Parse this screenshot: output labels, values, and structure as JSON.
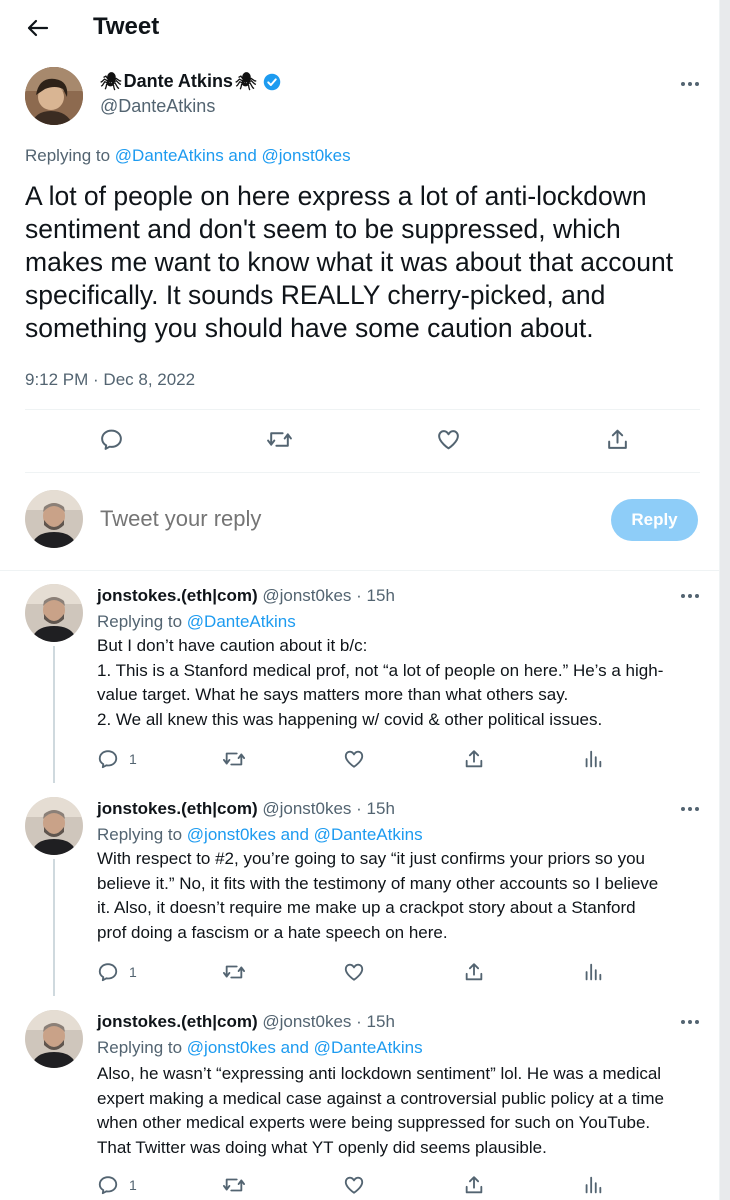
{
  "header": {
    "title": "Tweet"
  },
  "tweet": {
    "author_name": "Dante Atkins",
    "author_handle": "@DanteAtkins",
    "replying_prefix": "Replying to",
    "replying_to": "@DanteAtkins and @jonst0kes",
    "text": "A lot of people on here express a lot of anti-lockdown sentiment and don't seem to be suppressed, which makes me want to know what it was about that account specifically. It sounds REALLY cherry-picked, and something you should have some caution about.",
    "timestamp": "9:12 PM · Dec 8, 2022"
  },
  "compose": {
    "placeholder": "Tweet your reply",
    "button": "Reply"
  },
  "replies": [
    {
      "name": "jonstokes.(eth|com)",
      "meta": "@jonst0kes · 15h",
      "replying_to": "@DanteAtkins",
      "text_lines": [
        "But I don’t have caution about it b/c:",
        "1. This is a Stanford medical prof, not “a lot of people on here.” He’s a high-",
        "value target. What he says matters more than what others say.",
        "2. We all knew this was happening w/ covid & other political issues."
      ],
      "reply_count": "1"
    },
    {
      "name": "jonstokes.(eth|com)",
      "meta": "@jonst0kes · 15h",
      "replying_to": "@jonst0kes and @DanteAtkins",
      "text_lines": [
        "With respect to #2, you’re going to say “it just confirms your priors so you",
        "believe it.” No, it fits with the testimony of many other accounts so I believe",
        "it. Also, it doesn’t require me make up a crackpot story about a Stanford",
        "prof doing a fascism or a hate speech on here."
      ],
      "reply_count": "1"
    },
    {
      "name": "jonstokes.(eth|com)",
      "meta": "@jonst0kes · 15h",
      "replying_to": "@jonst0kes and @DanteAtkins",
      "text_lines": [
        "Also, he wasn’t “expressing anti lockdown sentiment” lol. He was a medical",
        "expert making a medical case against a controversial public policy at a time",
        "when other medical experts were being suppressed for such on YouTube.",
        "That Twitter was doing what YT openly did seems plausible."
      ],
      "reply_count": "1"
    }
  ],
  "colors": {
    "accent": "#1d9bf0",
    "muted": "#536471",
    "reply_button": "#8ecdf8"
  },
  "icons": [
    "back-arrow-icon",
    "spider-icon",
    "verified-badge-icon",
    "more-icon",
    "reply-icon",
    "retweet-icon",
    "like-icon",
    "share-icon",
    "analytics-icon"
  ]
}
